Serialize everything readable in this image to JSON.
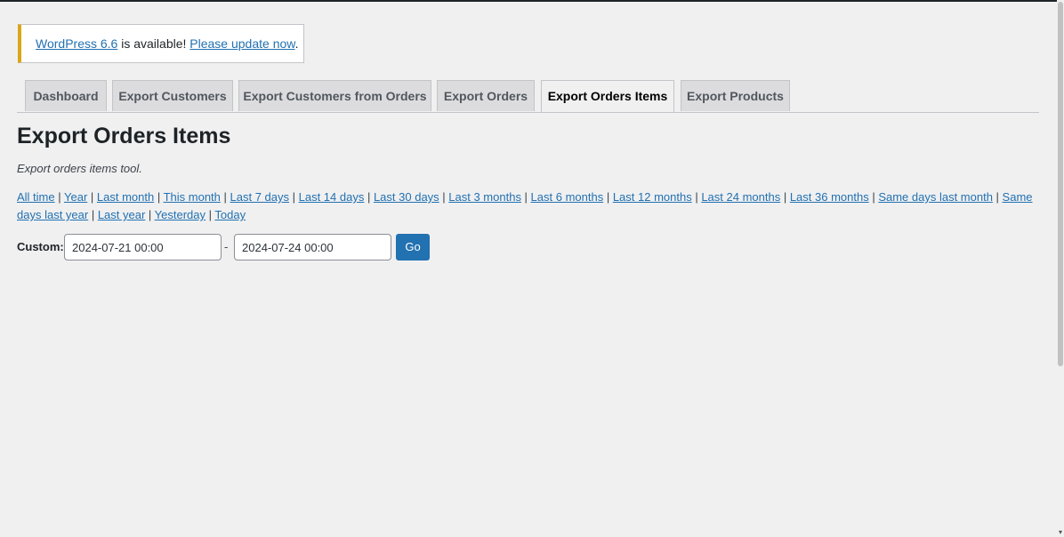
{
  "notice": {
    "version_link": "WordPress 6.6",
    "middle_text": " is available! ",
    "update_link": "Please update now",
    "end_text": "."
  },
  "tabs": [
    {
      "label": "Dashboard",
      "active": false
    },
    {
      "label": "Export Customers",
      "active": false
    },
    {
      "label": "Export Customers from Orders",
      "active": false
    },
    {
      "label": "Export Orders",
      "active": false
    },
    {
      "label": "Export Orders Items",
      "active": true
    },
    {
      "label": "Export Products",
      "active": false
    }
  ],
  "page": {
    "title": "Export Orders Items",
    "description": "Export orders items tool."
  },
  "ranges": [
    "All time",
    "Year",
    "Last month",
    "This month",
    "Last 7 days",
    "Last 14 days",
    "Last 30 days",
    "Last 3 months",
    "Last 6 months",
    "Last 12 months",
    "Last 24 months",
    "Last 36 months",
    "Same days last month",
    "Same days last year",
    "Last year",
    "Yesterday",
    "Today"
  ],
  "range_separator": " | ",
  "custom": {
    "label": "Custom:",
    "start_value": "2024-07-21 00:00",
    "dash": "-",
    "end_value": "2024-07-24 00:00",
    "go_label": "Go"
  },
  "colors": {
    "link": "#2271b1",
    "notice_accent": "#dba617",
    "primary_button": "#2271b1"
  }
}
